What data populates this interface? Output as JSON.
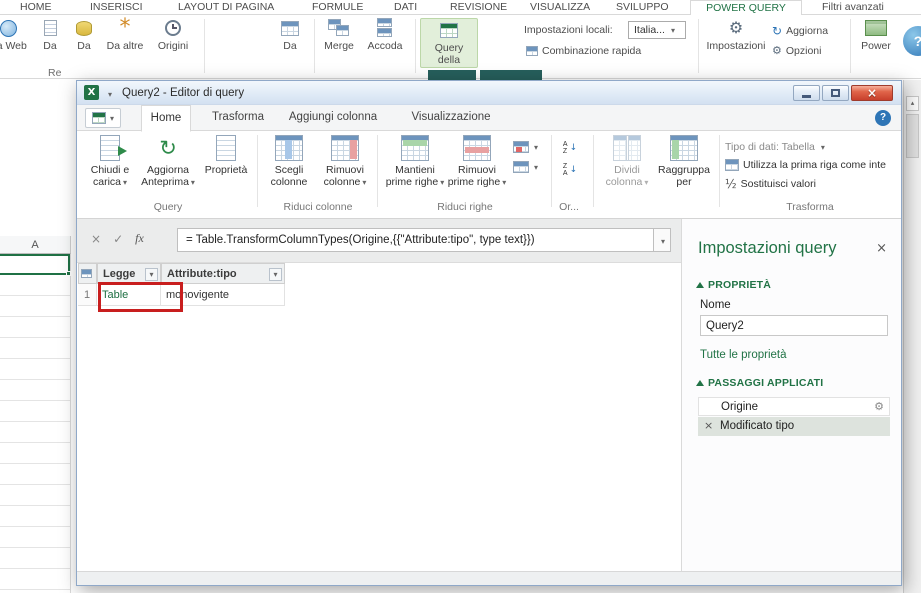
{
  "colors": {
    "excel_green": "#217346",
    "annotation_red": "#c81e1e",
    "selected_step_bg": "#dde3dd",
    "titlebar_blue": "#dfeaf6"
  },
  "icons": {
    "excel_logo": "X",
    "close_window": "×",
    "close_panel": "×",
    "delete_step": "×",
    "help": "?",
    "scroll_up": "▴",
    "arrow_down": "↓",
    "sort_a": "A",
    "sort_z": "Z",
    "fx": "fx",
    "check": "✓",
    "cancel": "×",
    "refresh": "↻",
    "gear": "⚙",
    "replace": "½"
  },
  "excel": {
    "tabs": [
      "HOME",
      "INSERISCI",
      "LAYOUT DI PAGINA",
      "FORMULE",
      "DATI",
      "REVISIONE",
      "VISUALIZZA",
      "SVILUPPO",
      "POWER QUERY",
      "Filtri avanzati"
    ],
    "ribbon": {
      "da_web": "Da Web",
      "da_file": "Da",
      "da_database": "Da",
      "da_altre": "Da altre",
      "origini": "Origini",
      "da_tabella": "Da",
      "merge": "Merge",
      "accoda": "Accoda",
      "query_della": "Query della",
      "impostazioni_locali_label": "Impostazioni locali:",
      "impostazioni_locali_value": "Italia...",
      "combinazione_rapida": "Combinazione rapida",
      "impostazioni": "Impostazioni",
      "aggiorna": "Aggiorna",
      "opzioni": "Opzioni",
      "power": "Power",
      "group_label_cut": "Re"
    },
    "sheet": {
      "column_a_header": "A"
    }
  },
  "editor": {
    "window_title": "Query2 - Editor di query",
    "tabs": [
      "Home",
      "Trasforma",
      "Aggiungi colonna",
      "Visualizzazione"
    ],
    "ribbon": {
      "chiudi_1": "Chiudi e",
      "chiudi_2": "carica",
      "aggiorna_1": "Aggiorna",
      "aggiorna_2": "Anteprima",
      "proprieta": "Proprietà",
      "group_query": "Query",
      "scegli_1": "Scegli",
      "scegli_2": "colonne",
      "rimuovi_col_1": "Rimuovi",
      "rimuovi_col_2": "colonne",
      "group_riduci_colonne": "Riduci colonne",
      "mantieni_1": "Mantieni",
      "mantieni_2": "prime righe",
      "rimuovi_righe_1": "Rimuovi",
      "rimuovi_righe_2": "prime righe",
      "group_riduci_righe": "Riduci righe",
      "group_ordina": "Or...",
      "dividi_1": "Dividi",
      "dividi_2": "colonna",
      "raggruppa_1": "Raggruppa",
      "raggruppa_2": "per",
      "tipo_di_dati": "Tipo di dati: Tabella",
      "prima_riga": "Utilizza la prima riga come inte",
      "sostituisci_valori": "Sostituisci valori",
      "group_trasforma": "Trasforma"
    },
    "formula_bar": {
      "formula": "= Table.TransformColumnTypes(Origine,{{\"Attribute:tipo\", type text}})"
    },
    "grid": {
      "columns": [
        "Legge",
        "Attribute:tipo"
      ],
      "rows": [
        {
          "num": "1",
          "legge": "Table",
          "attribute_tipo": "monovigente"
        }
      ]
    },
    "settings": {
      "title": "Impostazioni query",
      "proprieta_header": "PROPRIETÀ",
      "nome_label": "Nome",
      "nome_value": "Query2",
      "tutte_le_proprieta": "Tutte le proprietà",
      "passaggi_header": "PASSAGGI APPLICATI",
      "steps": [
        "Origine",
        "Modificato tipo"
      ]
    }
  }
}
